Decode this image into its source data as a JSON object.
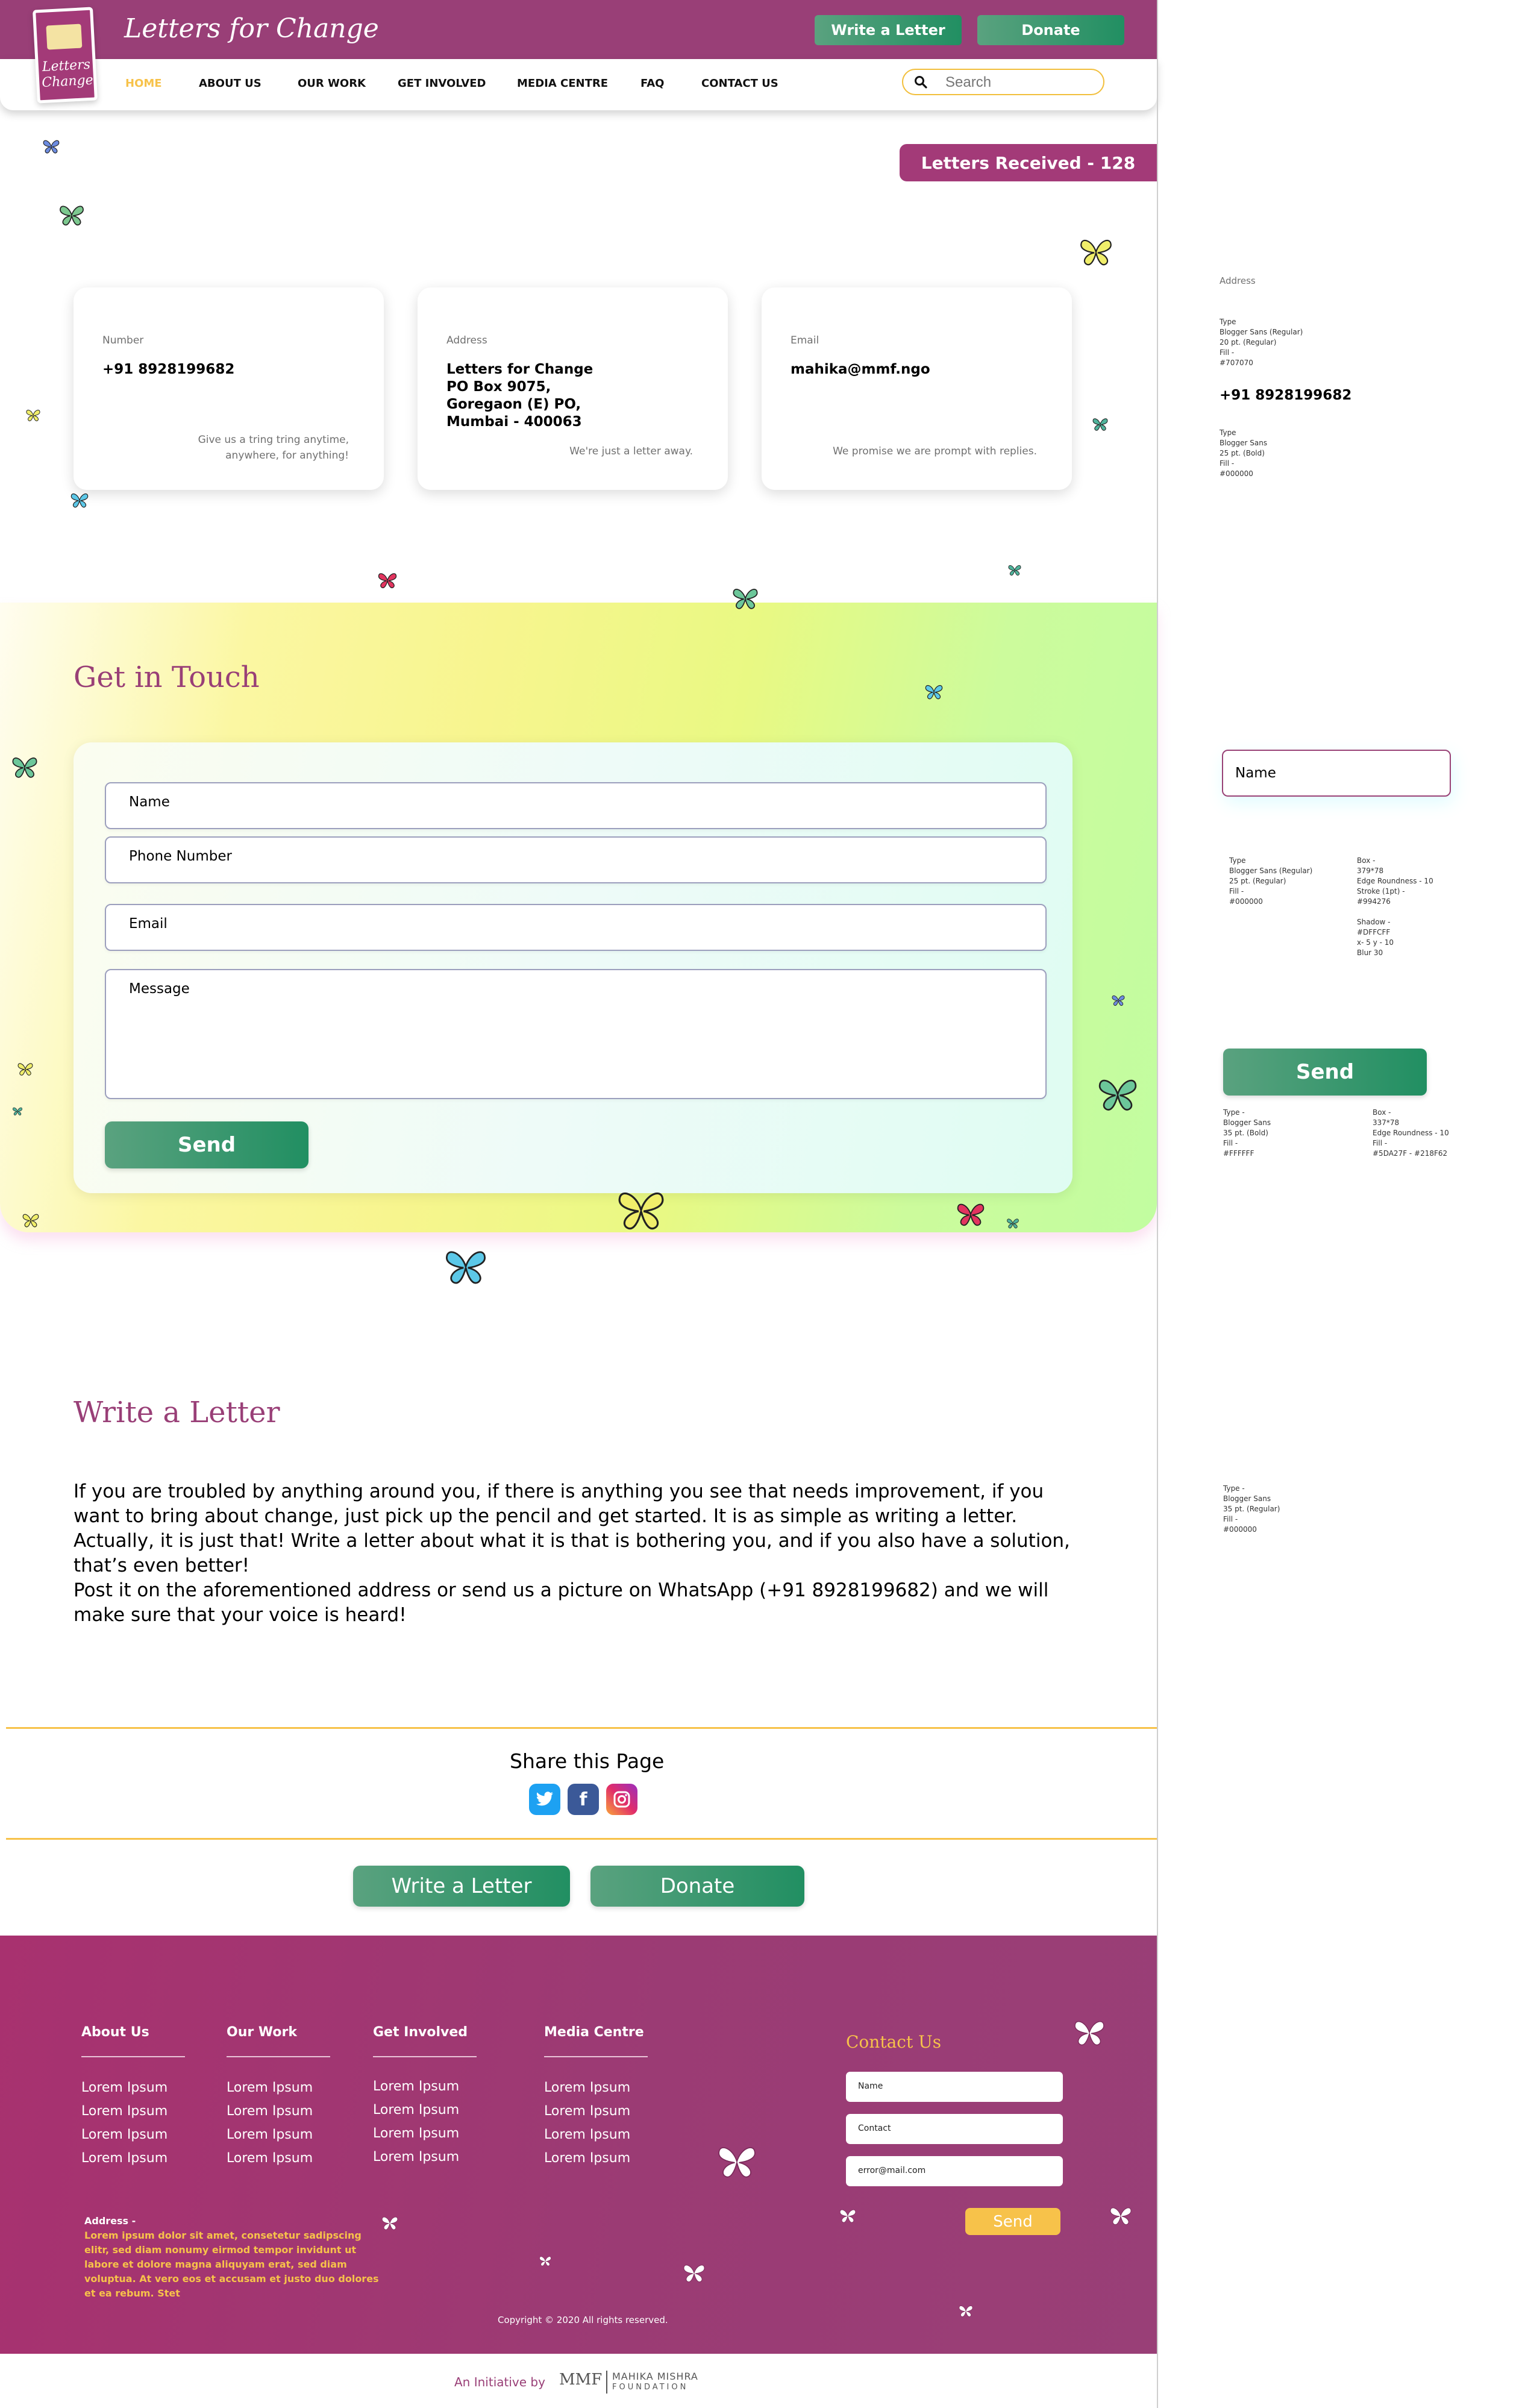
{
  "brand": {
    "name": "Letters for Change",
    "badge_line1": "Letters",
    "badge_line2": "Change"
  },
  "header": {
    "write_letter": "Write a Letter",
    "donate": "Donate"
  },
  "nav": {
    "items": [
      "HOME",
      "ABOUT US",
      "OUR WORK",
      "GET INVOLVED",
      "MEDIA CENTRE",
      "FAQ",
      "CONTACT US"
    ],
    "active": "HOME",
    "search_placeholder": "Search"
  },
  "letters_received": "Letters Received - 128",
  "contact_cards": [
    {
      "label": "Number",
      "value": "+91 8928199682",
      "note": "Give us a tring tring anytime,\nanywhere, for anything!"
    },
    {
      "label": "Address",
      "value": "Letters for Change\nPO Box 9075,\nGoregaon (E) PO,\nMumbai - 400063",
      "note": "We're just a letter away."
    },
    {
      "label": "Email",
      "value": "mahika@mmf.ngo",
      "note": "We promise we are prompt with replies."
    }
  ],
  "get_in_touch": {
    "title": "Get in Touch",
    "fields": [
      "Name",
      "Phone Number",
      "Email",
      "Message"
    ],
    "send": "Send"
  },
  "write_letter_section": {
    "title": "Write a Letter",
    "paragraph1": "If you are troubled by anything around you, if there is anything you see that needs improvement, if you want to bring about change, just pick up the pencil and get started. It is as simple as writing a letter. Actually, it is just that! Write a letter about what it is that is bothering you, and if you also have a solution, that’s even better!",
    "paragraph2": "Post it on the aforementioned address or send us a picture on WhatsApp (+91 8928199682) and we will make sure that your voice is heard!"
  },
  "share": {
    "title": "Share this Page",
    "icons": [
      "twitter-icon",
      "facebook-icon",
      "instagram-icon"
    ]
  },
  "cta": {
    "write_letter": "Write a Letter",
    "donate": "Donate"
  },
  "footer": {
    "columns": [
      {
        "heading": "About Us",
        "links": [
          "Lorem Ipsum",
          "Lorem Ipsum",
          "Lorem Ipsum",
          "Lorem Ipsum"
        ]
      },
      {
        "heading": "Our Work",
        "links": [
          "Lorem Ipsum",
          "Lorem Ipsum",
          "Lorem Ipsum",
          "Lorem Ipsum"
        ]
      },
      {
        "heading": "Get Involved",
        "links": [
          "Lorem Ipsum",
          "Lorem Ipsum",
          "Lorem Ipsum",
          "Lorem Ipsum"
        ]
      },
      {
        "heading": "Media Centre",
        "links": [
          "Lorem Ipsum",
          "Lorem Ipsum",
          "Lorem Ipsum",
          "Lorem Ipsum"
        ]
      }
    ],
    "contact": {
      "title": "Contact Us",
      "name_placeholder": "Name",
      "contact_placeholder": "Contact",
      "email_placeholder": "error@mail.com",
      "send": "Send"
    },
    "address_label": "Address -",
    "address_text": "Lorem ipsum dolor sit amet, consetetur sadipscing elitr, sed diam nonumy eirmod tempor invidunt ut labore et dolore magna aliquyam erat, sed diam voluptua. At vero eos et accusam et justo duo dolores et ea rebum. Stet",
    "copyright": "Copyright © 2020 All rights reserved."
  },
  "initiative": {
    "prefix": "An Initiative by",
    "org": "MAHIKA MISHRA",
    "org_sub": "FOUNDATION",
    "mark": "MMF"
  },
  "spec_panel": {
    "address_label": "Address",
    "type_spec_1": "Type\nBlogger Sans (Regular)\n20 pt. (Regular)\nFill -\n#707070",
    "phone_sample": "+91 8928199682",
    "type_spec_2": "Type\nBlogger Sans\n25 pt. (Bold)\nFill -\n#000000",
    "name_sample": "Name",
    "field_type_spec": "Type\nBlogger Sans (Regular)\n25 pt. (Regular)\nFill -\n#000000",
    "field_box_spec": "Box -\n379*78\nEdge Roundness - 10\nStroke (1pt) -\n#994276\n\nShadow -\n#DFFCFF\nx- 5 y - 10\nBlur 30",
    "send_sample": "Send",
    "button_type_spec": "Type -\nBlogger Sans\n35 pt. (Bold)\nFill -\n#FFFFFF",
    "button_box_spec": "Box -\n337*78\nEdge Roundness - 10\nFill -\n#5DA27F - #218F62",
    "heading_type_spec": "Type -\nBlogger Sans\n35 pt. (Regular)\nFill -\n#000000"
  },
  "colors": {
    "brand_purple": "#993f77",
    "accent_yellow": "#f7c24a",
    "button_green_start": "#5aa27f",
    "button_green_end": "#218f62"
  }
}
